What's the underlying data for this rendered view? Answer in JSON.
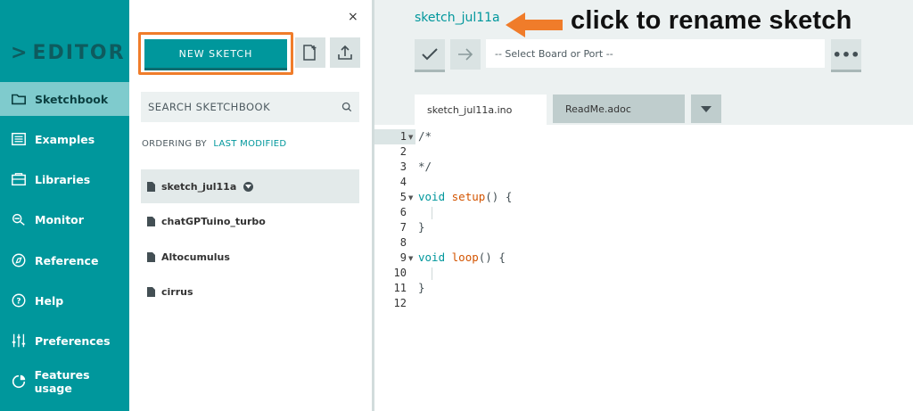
{
  "nav": {
    "brand": "EDITOR",
    "items": [
      {
        "label": "Sketchbook",
        "icon": "folder-icon"
      },
      {
        "label": "Examples",
        "icon": "list-icon"
      },
      {
        "label": "Libraries",
        "icon": "library-icon"
      },
      {
        "label": "Monitor",
        "icon": "monitor-icon"
      },
      {
        "label": "Reference",
        "icon": "compass-icon"
      },
      {
        "label": "Help",
        "icon": "help-icon"
      },
      {
        "label": "Preferences",
        "icon": "sliders-icon"
      },
      {
        "label": "Features usage",
        "icon": "pie-icon"
      }
    ]
  },
  "panel": {
    "close_label": "×",
    "new_sketch_label": "NEW SKETCH",
    "search_label": "SEARCH SKETCHBOOK",
    "ordering_label": "ORDERING BY",
    "ordering_value": "LAST MODIFIED",
    "sketches": [
      "sketch_jul11a",
      "chatGPTuino_turbo",
      "Altocumulus",
      "cirrus"
    ]
  },
  "editor": {
    "sketch_name": "sketch_jul11a",
    "board_placeholder": "-- Select Board or Port --",
    "more_label": "•••",
    "tabs": [
      "sketch_jul11a.ino",
      "ReadMe.adoc"
    ],
    "line_numbers": [
      "1",
      "2",
      "3",
      "4",
      "5",
      "6",
      "7",
      "8",
      "9",
      "10",
      "11",
      "12"
    ],
    "code": {
      "l1": "/*",
      "l3": "*/",
      "l5_kw": "void",
      "l5_fn": "setup",
      "l5_rest": "() {",
      "l7": "}",
      "l9_kw": "void",
      "l9_fn": "loop",
      "l9_rest": "() {",
      "l11": "}"
    }
  },
  "annotation": {
    "text": "click to rename sketch",
    "color": "#f07c2a"
  },
  "colors": {
    "teal": "#00979c",
    "orange": "#f07c2a"
  }
}
